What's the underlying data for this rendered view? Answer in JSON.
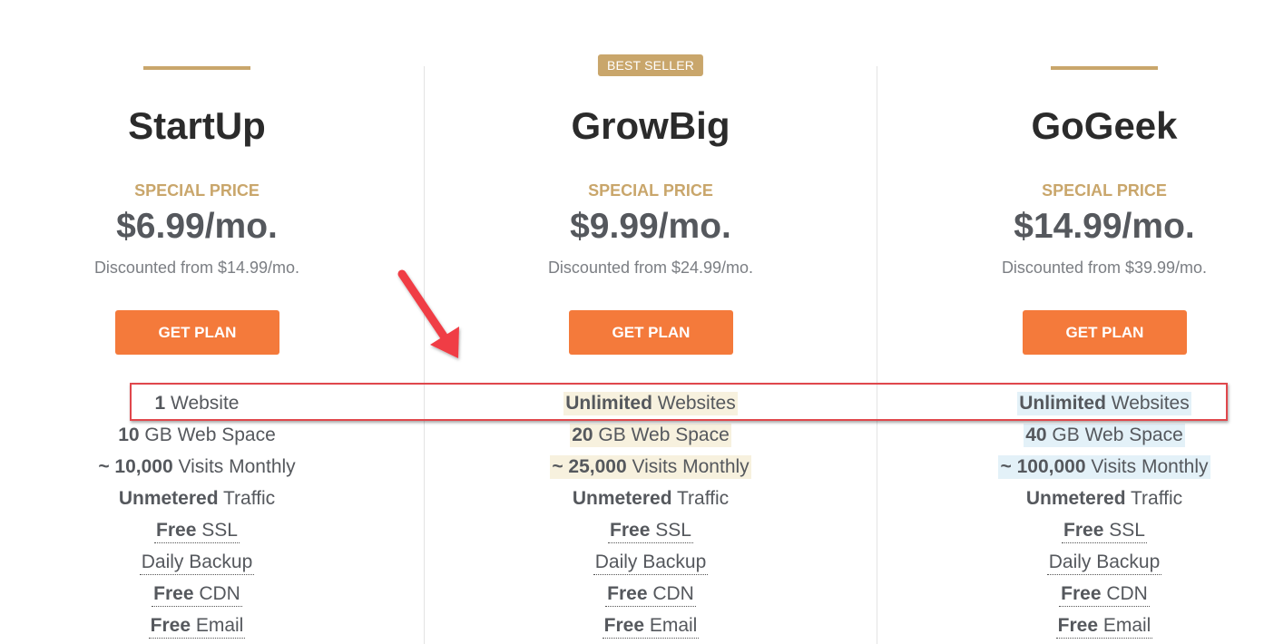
{
  "colors": {
    "accent_gold": "#c9a66b",
    "button_orange": "#f47a3b",
    "annotation_red": "#e0474c",
    "highlight_gold": "#f7f1de",
    "highlight_blue": "#e3f1f8"
  },
  "annotation": {
    "arrow_icon": "red-arrow-pointing-down-right",
    "box": "red-rectangle-around-website-count-row"
  },
  "plans": [
    {
      "badge": null,
      "name": "StartUp",
      "special_label": "SPECIAL PRICE",
      "price": "$6.99/mo.",
      "discount": "Discounted from $14.99/mo.",
      "button": "GET PLAN",
      "features": [
        {
          "bold": "1",
          "text": " Website"
        },
        {
          "bold": "10",
          "text": " GB Web Space"
        },
        {
          "bold": "~ 10,000",
          "text": " Visits Monthly"
        },
        {
          "bold": "Unmetered",
          "text": " Traffic"
        },
        {
          "bold": "Free",
          "text": " SSL"
        },
        {
          "bold": "",
          "text": "Daily Backup"
        },
        {
          "bold": "Free",
          "text": " CDN"
        },
        {
          "bold": "Free",
          "text": " Email"
        }
      ]
    },
    {
      "badge": "BEST SELLER",
      "name": "GrowBig",
      "special_label": "SPECIAL PRICE",
      "price": "$9.99/mo.",
      "discount": "Discounted from $24.99/mo.",
      "button": "GET PLAN",
      "features": [
        {
          "bold": "Unlimited",
          "text": " Websites"
        },
        {
          "bold": "20",
          "text": " GB Web Space"
        },
        {
          "bold": "~ 25,000",
          "text": " Visits Monthly"
        },
        {
          "bold": "Unmetered",
          "text": " Traffic"
        },
        {
          "bold": "Free",
          "text": " SSL"
        },
        {
          "bold": "",
          "text": "Daily Backup"
        },
        {
          "bold": "Free",
          "text": " CDN"
        },
        {
          "bold": "Free",
          "text": " Email"
        }
      ]
    },
    {
      "badge": null,
      "name": "GoGeek",
      "special_label": "SPECIAL PRICE",
      "price": "$14.99/mo.",
      "discount": "Discounted from $39.99/mo.",
      "button": "GET PLAN",
      "features": [
        {
          "bold": "Unlimited",
          "text": " Websites"
        },
        {
          "bold": "40",
          "text": " GB Web Space"
        },
        {
          "bold": "~ 100,000",
          "text": " Visits Monthly"
        },
        {
          "bold": "Unmetered",
          "text": " Traffic"
        },
        {
          "bold": "Free",
          "text": " SSL"
        },
        {
          "bold": "",
          "text": "Daily Backup"
        },
        {
          "bold": "Free",
          "text": " CDN"
        },
        {
          "bold": "Free",
          "text": " Email"
        }
      ]
    }
  ]
}
